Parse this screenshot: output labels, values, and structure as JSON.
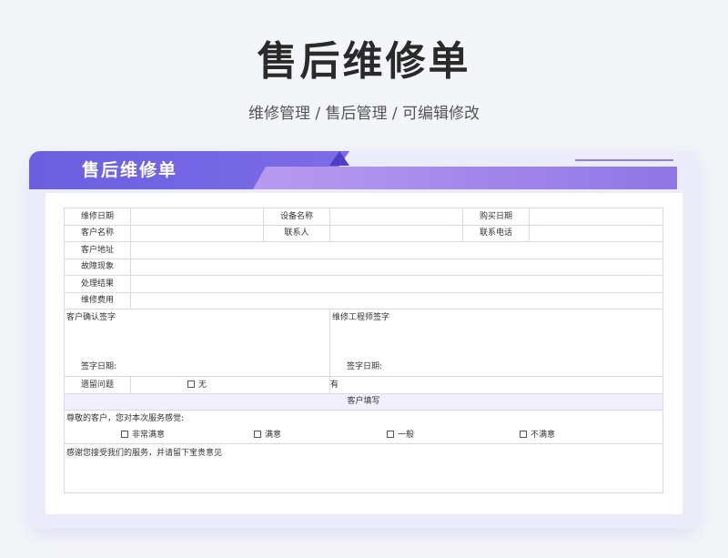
{
  "page": {
    "title": "售后维修单",
    "subtitle": "维修管理 / 售后管理 /  可编辑修改"
  },
  "card": {
    "banner_title": "售后维修单"
  },
  "form": {
    "repair_date": "维修日期",
    "device_name": "设备名称",
    "purchase_date": "购买日期",
    "customer_name": "客户名称",
    "contact_person": "联系人",
    "contact_phone": "联系电话",
    "customer_address": "客户地址",
    "fault_symptom": "故障现象",
    "handling_result": "处理结果",
    "repair_cost": "维修费用",
    "customer_signature": "客户确认签字",
    "engineer_signature": "维修工程师签字",
    "sign_date_1": "签字日期:",
    "sign_date_2": "签字日期:",
    "remaining_issues": "遗留问题",
    "option_none": "无",
    "option_yes": "有",
    "customer_section": "客户填写",
    "satisfaction_question": "尊敬的客户，您对本次服务感觉:",
    "sat_options": [
      "非常满意",
      "满意",
      "一般",
      "不满意"
    ],
    "thanks_note": "感谢您接受我们的服务，并请留下宝贵意见"
  },
  "colors": {
    "accent": "#6a5fe0",
    "accent_light": "#b89bf0",
    "card_bg": "#ecebfa"
  }
}
